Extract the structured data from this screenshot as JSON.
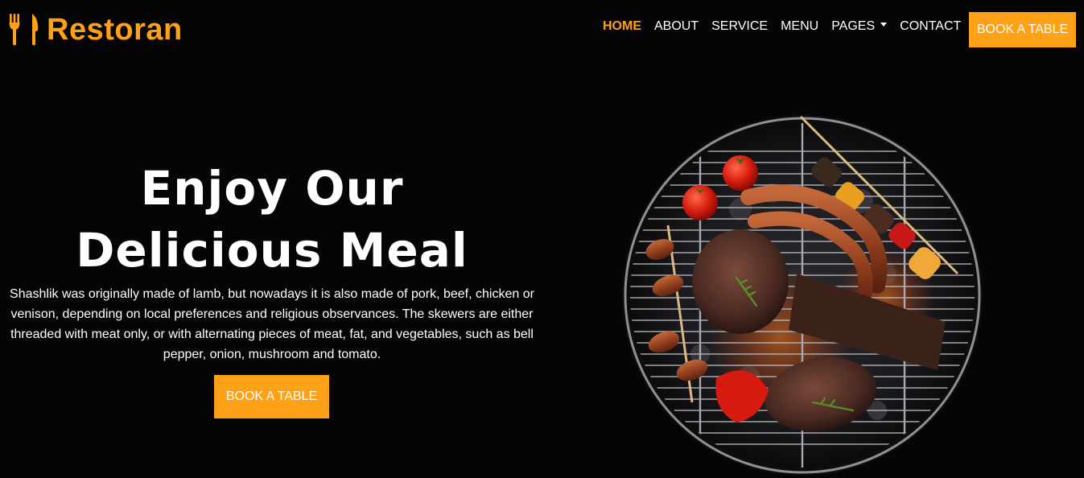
{
  "brand": {
    "name": "Restoran",
    "icon": "utensils-icon",
    "color": "#FEA116"
  },
  "nav": {
    "links": [
      {
        "label": "HOME",
        "active": true
      },
      {
        "label": "ABOUT",
        "active": false
      },
      {
        "label": "SERVICE",
        "active": false
      },
      {
        "label": "MENU",
        "active": false
      },
      {
        "label": "PAGES",
        "active": false,
        "dropdown": true
      },
      {
        "label": "CONTACT",
        "active": false
      }
    ],
    "cta_label": "BOOK A TABLE"
  },
  "hero": {
    "title_line1": "Enjoy Our",
    "title_line2": "Delicious Meal",
    "description": "Shashlik was originally made of lamb, but nowadays it is also made of pork, beef, chicken or venison, depending on local preferences and religious observances. The skewers are either threaded with meat only, or with alternating pieces of meat, fat, and vegetables, such as bell pepper, onion, mushroom and tomato.",
    "cta_label": "BOOK A TABLE",
    "image": "grilled-meat-on-barbecue-grill"
  },
  "colors": {
    "accent": "#FEA116",
    "background": "#050505",
    "text": "#FFFFFF"
  }
}
